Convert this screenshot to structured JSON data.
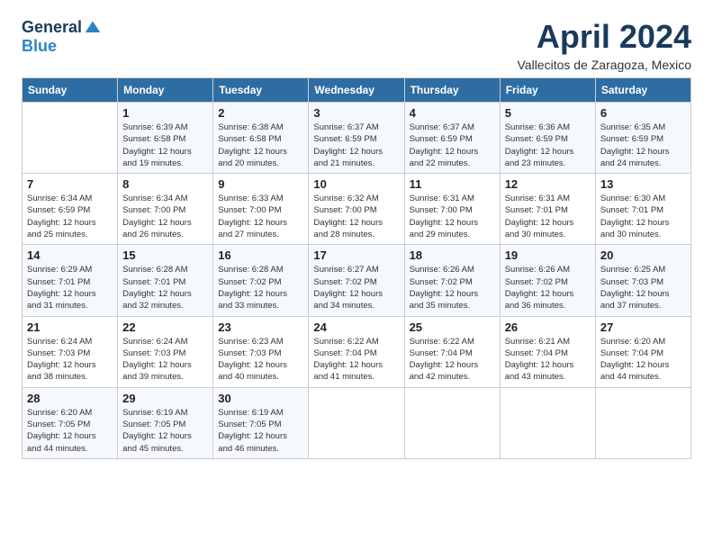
{
  "logo": {
    "general": "General",
    "blue": "Blue"
  },
  "header": {
    "month": "April 2024",
    "location": "Vallecitos de Zaragoza, Mexico"
  },
  "days_of_week": [
    "Sunday",
    "Monday",
    "Tuesday",
    "Wednesday",
    "Thursday",
    "Friday",
    "Saturday"
  ],
  "weeks": [
    [
      {
        "num": "",
        "info": ""
      },
      {
        "num": "1",
        "info": "Sunrise: 6:39 AM\nSunset: 6:58 PM\nDaylight: 12 hours\nand 19 minutes."
      },
      {
        "num": "2",
        "info": "Sunrise: 6:38 AM\nSunset: 6:58 PM\nDaylight: 12 hours\nand 20 minutes."
      },
      {
        "num": "3",
        "info": "Sunrise: 6:37 AM\nSunset: 6:59 PM\nDaylight: 12 hours\nand 21 minutes."
      },
      {
        "num": "4",
        "info": "Sunrise: 6:37 AM\nSunset: 6:59 PM\nDaylight: 12 hours\nand 22 minutes."
      },
      {
        "num": "5",
        "info": "Sunrise: 6:36 AM\nSunset: 6:59 PM\nDaylight: 12 hours\nand 23 minutes."
      },
      {
        "num": "6",
        "info": "Sunrise: 6:35 AM\nSunset: 6:59 PM\nDaylight: 12 hours\nand 24 minutes."
      }
    ],
    [
      {
        "num": "7",
        "info": "Sunrise: 6:34 AM\nSunset: 6:59 PM\nDaylight: 12 hours\nand 25 minutes."
      },
      {
        "num": "8",
        "info": "Sunrise: 6:34 AM\nSunset: 7:00 PM\nDaylight: 12 hours\nand 26 minutes."
      },
      {
        "num": "9",
        "info": "Sunrise: 6:33 AM\nSunset: 7:00 PM\nDaylight: 12 hours\nand 27 minutes."
      },
      {
        "num": "10",
        "info": "Sunrise: 6:32 AM\nSunset: 7:00 PM\nDaylight: 12 hours\nand 28 minutes."
      },
      {
        "num": "11",
        "info": "Sunrise: 6:31 AM\nSunset: 7:00 PM\nDaylight: 12 hours\nand 29 minutes."
      },
      {
        "num": "12",
        "info": "Sunrise: 6:31 AM\nSunset: 7:01 PM\nDaylight: 12 hours\nand 30 minutes."
      },
      {
        "num": "13",
        "info": "Sunrise: 6:30 AM\nSunset: 7:01 PM\nDaylight: 12 hours\nand 30 minutes."
      }
    ],
    [
      {
        "num": "14",
        "info": "Sunrise: 6:29 AM\nSunset: 7:01 PM\nDaylight: 12 hours\nand 31 minutes."
      },
      {
        "num": "15",
        "info": "Sunrise: 6:28 AM\nSunset: 7:01 PM\nDaylight: 12 hours\nand 32 minutes."
      },
      {
        "num": "16",
        "info": "Sunrise: 6:28 AM\nSunset: 7:02 PM\nDaylight: 12 hours\nand 33 minutes."
      },
      {
        "num": "17",
        "info": "Sunrise: 6:27 AM\nSunset: 7:02 PM\nDaylight: 12 hours\nand 34 minutes."
      },
      {
        "num": "18",
        "info": "Sunrise: 6:26 AM\nSunset: 7:02 PM\nDaylight: 12 hours\nand 35 minutes."
      },
      {
        "num": "19",
        "info": "Sunrise: 6:26 AM\nSunset: 7:02 PM\nDaylight: 12 hours\nand 36 minutes."
      },
      {
        "num": "20",
        "info": "Sunrise: 6:25 AM\nSunset: 7:03 PM\nDaylight: 12 hours\nand 37 minutes."
      }
    ],
    [
      {
        "num": "21",
        "info": "Sunrise: 6:24 AM\nSunset: 7:03 PM\nDaylight: 12 hours\nand 38 minutes."
      },
      {
        "num": "22",
        "info": "Sunrise: 6:24 AM\nSunset: 7:03 PM\nDaylight: 12 hours\nand 39 minutes."
      },
      {
        "num": "23",
        "info": "Sunrise: 6:23 AM\nSunset: 7:03 PM\nDaylight: 12 hours\nand 40 minutes."
      },
      {
        "num": "24",
        "info": "Sunrise: 6:22 AM\nSunset: 7:04 PM\nDaylight: 12 hours\nand 41 minutes."
      },
      {
        "num": "25",
        "info": "Sunrise: 6:22 AM\nSunset: 7:04 PM\nDaylight: 12 hours\nand 42 minutes."
      },
      {
        "num": "26",
        "info": "Sunrise: 6:21 AM\nSunset: 7:04 PM\nDaylight: 12 hours\nand 43 minutes."
      },
      {
        "num": "27",
        "info": "Sunrise: 6:20 AM\nSunset: 7:04 PM\nDaylight: 12 hours\nand 44 minutes."
      }
    ],
    [
      {
        "num": "28",
        "info": "Sunrise: 6:20 AM\nSunset: 7:05 PM\nDaylight: 12 hours\nand 44 minutes."
      },
      {
        "num": "29",
        "info": "Sunrise: 6:19 AM\nSunset: 7:05 PM\nDaylight: 12 hours\nand 45 minutes."
      },
      {
        "num": "30",
        "info": "Sunrise: 6:19 AM\nSunset: 7:05 PM\nDaylight: 12 hours\nand 46 minutes."
      },
      {
        "num": "",
        "info": ""
      },
      {
        "num": "",
        "info": ""
      },
      {
        "num": "",
        "info": ""
      },
      {
        "num": "",
        "info": ""
      }
    ]
  ]
}
